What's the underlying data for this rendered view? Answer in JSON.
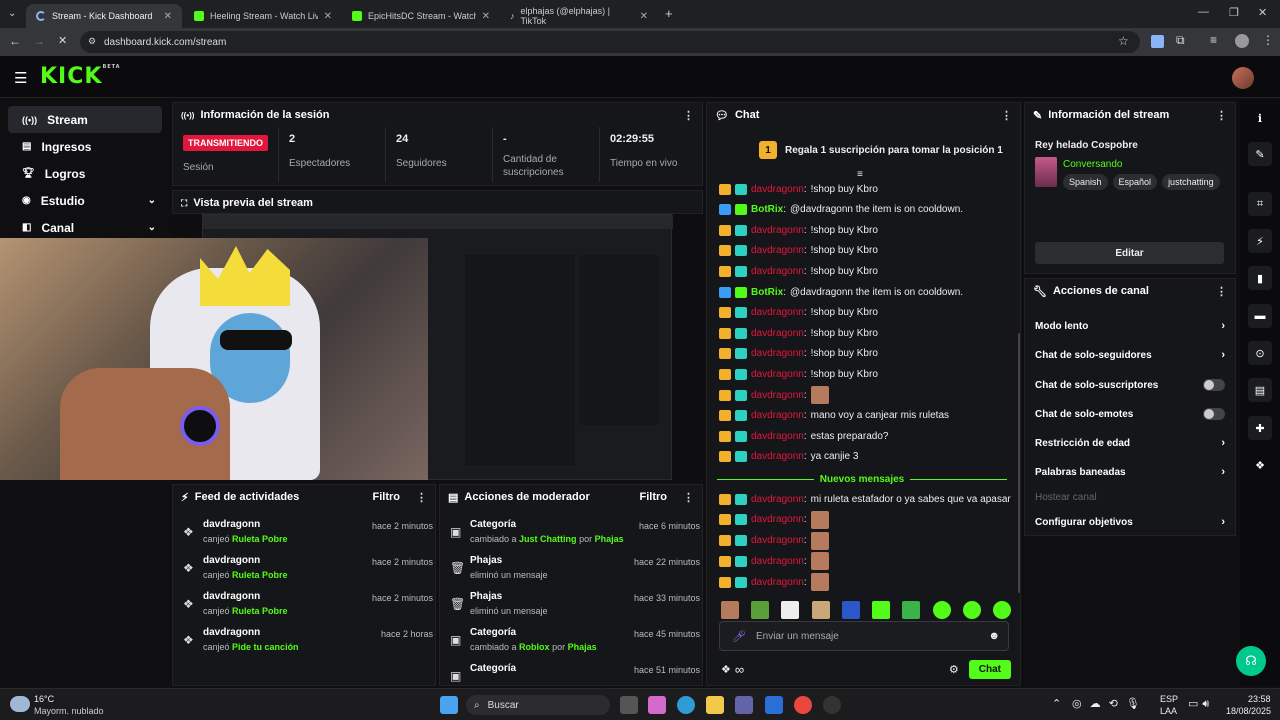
{
  "browser": {
    "tabs": [
      {
        "title": "Stream - Kick Dashboard"
      },
      {
        "title": "Heeling Stream - Watch Live on"
      },
      {
        "title": "EpicHitsDC Stream - Watch Live"
      },
      {
        "title": "elphajas (@elphajas) | TikTok"
      }
    ],
    "url": "dashboard.kick.com/stream"
  },
  "brand": {
    "logo": "KICK",
    "beta": "BETA",
    "accent": "#53fc18"
  },
  "sidebar": {
    "items": [
      {
        "label": "Stream"
      },
      {
        "label": "Ingresos"
      },
      {
        "label": "Logros"
      },
      {
        "label": "Estudio"
      },
      {
        "label": "Canal"
      }
    ]
  },
  "session": {
    "title": "Información de la sesión",
    "live_badge": "TRANSMITIENDO",
    "session_label": "Sesión",
    "stats": [
      {
        "value": "2",
        "label": "Espectadores"
      },
      {
        "value": "24",
        "label": "Seguidores"
      },
      {
        "value": "-",
        "label": "Cantidad de suscripciones"
      },
      {
        "value": "02:29:55",
        "label": "Tiempo en vivo"
      }
    ]
  },
  "preview": {
    "title": "Vista previa del stream"
  },
  "feed": {
    "title": "Feed de actividades",
    "filter": "Filtro",
    "items": [
      {
        "name": "davdragonn",
        "action": "canjeó",
        "reward": "Ruleta Pobre",
        "time": "hace 2 minutos"
      },
      {
        "name": "davdragonn",
        "action": "canjeó",
        "reward": "Ruleta Pobre",
        "time": "hace 2 minutos"
      },
      {
        "name": "davdragonn",
        "action": "canjeó",
        "reward": "Ruleta Pobre",
        "time": "hace 2 minutos"
      },
      {
        "name": "davdragonn",
        "action": "canjeó",
        "reward": "Pide tu canción",
        "time": "hace 2 horas"
      }
    ]
  },
  "modactions": {
    "title": "Acciones de moderador",
    "filter": "Filtro",
    "items": [
      {
        "title": "Categoría",
        "pre": "cambiado a",
        "target": "Just Chatting",
        "by": "por",
        "who": "Phajas",
        "time": "hace 6 minutos"
      },
      {
        "title": "Phajas",
        "pre": "eliminó un mensaje",
        "target": "",
        "by": "",
        "who": "",
        "time": "hace 22 minutos"
      },
      {
        "title": "Phajas",
        "pre": "eliminó un mensaje",
        "target": "",
        "by": "",
        "who": "",
        "time": "hace 33 minutos"
      },
      {
        "title": "Categoría",
        "pre": "cambiado a",
        "target": "Roblox",
        "by": "por",
        "who": "Phajas",
        "time": "hace 45 minutos"
      },
      {
        "title": "Categoría",
        "pre": "",
        "target": "",
        "by": "",
        "who": "",
        "time": "hace 51 minutos"
      }
    ]
  },
  "chat": {
    "title": "Chat",
    "gift_rank": "1",
    "gift_text_a": "Regala ",
    "gift_text_b": "1",
    "gift_text_c": " suscripción para tomar la posición 1",
    "new_messages": "Nuevos mensajes",
    "input_placeholder": "Enviar un mensaje",
    "send": "Chat",
    "messages": [
      {
        "user": "davdragonn",
        "text": "!shop buy Kbro",
        "bot": false,
        "emote": false
      },
      {
        "user": "BotRix",
        "text": "@davdragonn the item is on cooldown.",
        "bot": true,
        "emote": false
      },
      {
        "user": "davdragonn",
        "text": "!shop buy Kbro",
        "bot": false,
        "emote": false
      },
      {
        "user": "davdragonn",
        "text": "!shop buy Kbro",
        "bot": false,
        "emote": false
      },
      {
        "user": "davdragonn",
        "text": "!shop buy Kbro",
        "bot": false,
        "emote": false
      },
      {
        "user": "BotRix",
        "text": "@davdragonn the item is on cooldown.",
        "bot": true,
        "emote": false
      },
      {
        "user": "davdragonn",
        "text": "!shop buy Kbro",
        "bot": false,
        "emote": false
      },
      {
        "user": "davdragonn",
        "text": "!shop buy Kbro",
        "bot": false,
        "emote": false
      },
      {
        "user": "davdragonn",
        "text": "!shop buy Kbro",
        "bot": false,
        "emote": false
      },
      {
        "user": "davdragonn",
        "text": "!shop buy Kbro",
        "bot": false,
        "emote": false
      },
      {
        "user": "davdragonn",
        "text": "",
        "bot": false,
        "emote": true
      },
      {
        "user": "davdragonn",
        "text": "mano voy a canjear mis ruletas",
        "bot": false,
        "emote": false
      },
      {
        "user": "davdragonn",
        "text": "estas preparado?",
        "bot": false,
        "emote": false
      },
      {
        "user": "davdragonn",
        "text": "ya canjie 3",
        "bot": false,
        "emote": false
      }
    ],
    "messages_after": [
      {
        "user": "davdragonn",
        "text": "mi ruleta estafador o ya sabes que va apasar",
        "emote": false
      },
      {
        "user": "davdragonn",
        "text": "",
        "emote": true
      },
      {
        "user": "davdragonn",
        "text": "",
        "emote": true
      },
      {
        "user": "davdragonn",
        "text": "",
        "emote": true
      },
      {
        "user": "davdragonn",
        "text": "",
        "emote": true
      }
    ]
  },
  "streaminfo": {
    "title": "Información del stream",
    "stream_title": "Rey helado Cospobre",
    "category": "Conversando",
    "tags": [
      "Spanish",
      "Español",
      "justchatting"
    ],
    "edit": "Editar"
  },
  "channelactions": {
    "title": "Acciones de canal",
    "items": [
      {
        "label": "Modo lento",
        "kind": "chevron"
      },
      {
        "label": "Chat de solo-seguidores",
        "kind": "chevron"
      },
      {
        "label": "Chat de solo-suscriptores",
        "kind": "toggle"
      },
      {
        "label": "Chat de solo-emotes",
        "kind": "toggle"
      },
      {
        "label": "Restricción de edad",
        "kind": "chevron"
      },
      {
        "label": "Palabras baneadas",
        "kind": "chevron"
      },
      {
        "label": "Hostear canal",
        "kind": "disabled"
      },
      {
        "label": "Configurar objetivos",
        "kind": "chevron"
      }
    ]
  },
  "taskbar": {
    "weather_temp": "16°C",
    "weather_desc": "Mayorm. nublado",
    "search": "Buscar",
    "lang1": "ESP",
    "lang2": "LAA",
    "time": "23:58",
    "date": "18/08/2025"
  }
}
